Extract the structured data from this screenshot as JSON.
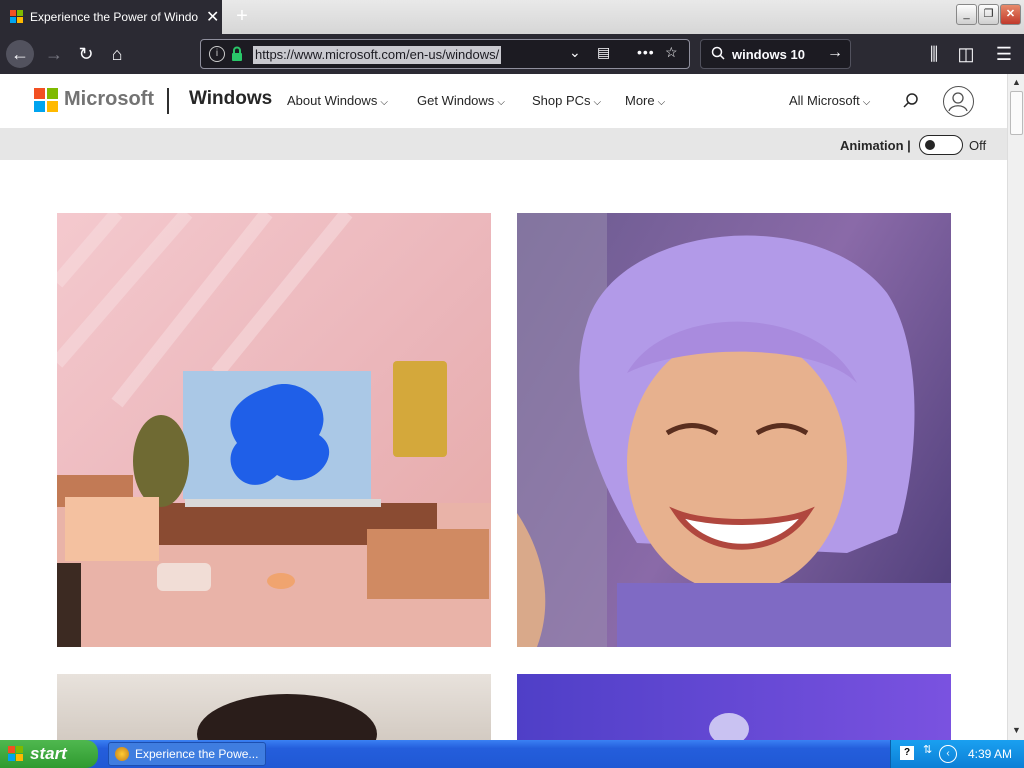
{
  "browser": {
    "tab_title": "Experience the Power of Windows",
    "url": "https://www.microsoft.com/en-us/windows/",
    "search_query": "windows 10"
  },
  "header": {
    "brand": "Microsoft",
    "product": "Windows",
    "nav": [
      {
        "label": "About Windows"
      },
      {
        "label": "Get Windows"
      },
      {
        "label": "Shop PCs"
      },
      {
        "label": "More"
      }
    ],
    "all_microsoft": "All Microsoft"
  },
  "animation": {
    "label": "Animation |",
    "state": "Off"
  },
  "taskbar": {
    "start_label": "start",
    "task_item": "Experience the Powe...",
    "clock": "4:39 AM"
  },
  "colors": {
    "ms_red": "#f25022",
    "ms_green": "#7fba00",
    "ms_blue": "#00a4ef",
    "ms_yellow": "#ffb900",
    "browser_dark": "#2b2a33"
  },
  "icons": [
    "info-icon",
    "lock-icon",
    "reader-icon",
    "more-icon",
    "bookmark-star-icon",
    "search-icon",
    "library-icon",
    "sidebar-icon",
    "menu-icon",
    "back-icon",
    "forward-icon",
    "reload-icon",
    "home-icon",
    "close-icon",
    "avatar-icon"
  ]
}
